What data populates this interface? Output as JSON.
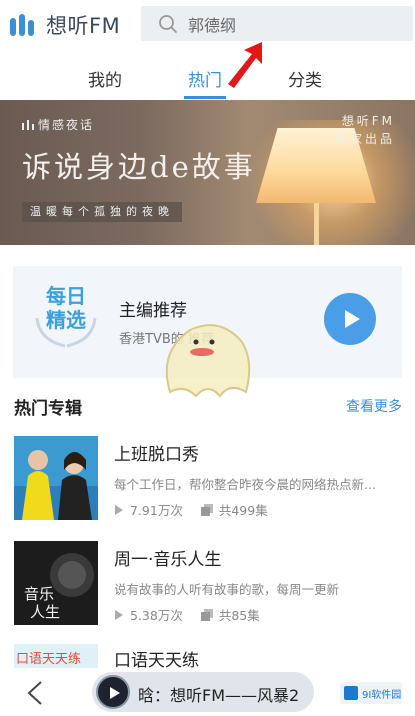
{
  "app": {
    "name": "想听FM"
  },
  "search": {
    "text": "郭德纲"
  },
  "tabs": [
    {
      "label": "我的"
    },
    {
      "label": "热门"
    },
    {
      "label": "分类"
    }
  ],
  "banner": {
    "tag": "情感夜话",
    "title": "诉说身边de故事",
    "subtitle": "温暖每个孤独的夜晚",
    "brand_line1": "想听FM",
    "brand_line2": "独家出品"
  },
  "daily": {
    "badge": "每日精选",
    "title": "主编推荐",
    "subtitle": "香港TVB的 推荐"
  },
  "section": {
    "title": "热门专辑",
    "more": "查看更多"
  },
  "albums": [
    {
      "title": "上班脱口秀",
      "desc": "每个工作日，帮你整合昨夜今晨的网络热点新...",
      "plays": "7.91万次",
      "episodes": "共499集"
    },
    {
      "title": "周一·音乐人生",
      "desc": "说有故事的人听有故事的歌，每周一更新",
      "plays": "5.38万次",
      "episodes": "共85集",
      "cover_text": "音乐\n人生"
    },
    {
      "title": "口语天天练",
      "cover_text": "口语天天练"
    }
  ],
  "player": {
    "now_playing": "晗：想听FM——风暴2",
    "logo_text": "9I软件园"
  },
  "colors": {
    "accent": "#3b8fd8",
    "play": "#4a9ee8",
    "daily_bg": "#f2f6fb"
  }
}
